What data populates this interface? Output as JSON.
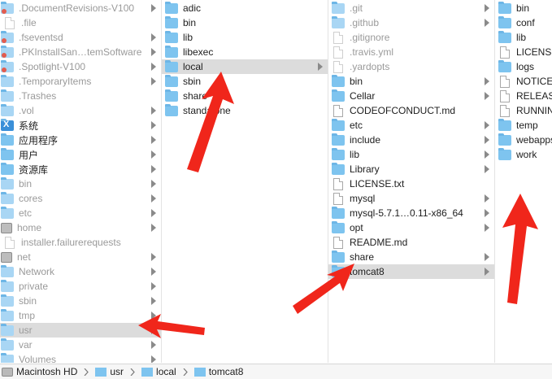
{
  "columns": [
    {
      "items": [
        {
          "label": ".DocumentRevisions-V100",
          "icon": "folder",
          "hidden": true,
          "badge": true,
          "chevron": true
        },
        {
          "label": ".file",
          "icon": "file",
          "hidden": true
        },
        {
          "label": ".fseventsd",
          "icon": "folder",
          "hidden": true,
          "badge": true,
          "chevron": true
        },
        {
          "label": ".PKInstallSan…temSoftware",
          "icon": "folder",
          "hidden": true,
          "badge": true,
          "chevron": true
        },
        {
          "label": ".Spotlight-V100",
          "icon": "folder",
          "hidden": true,
          "badge": true,
          "chevron": true
        },
        {
          "label": ".TemporaryItems",
          "icon": "folder",
          "hidden": true,
          "chevron": true
        },
        {
          "label": ".Trashes",
          "icon": "folder",
          "hidden": true
        },
        {
          "label": ".vol",
          "icon": "folder",
          "hidden": true,
          "chevron": true
        },
        {
          "label": "系统",
          "icon": "system",
          "chevron": true
        },
        {
          "label": "应用程序",
          "icon": "folder",
          "chevron": true
        },
        {
          "label": "用户",
          "icon": "folder",
          "chevron": true
        },
        {
          "label": "资源库",
          "icon": "folder",
          "chevron": true
        },
        {
          "label": "bin",
          "icon": "folder",
          "hidden": true,
          "chevron": true
        },
        {
          "label": "cores",
          "icon": "folder",
          "hidden": true,
          "chevron": true
        },
        {
          "label": "etc",
          "icon": "folder",
          "hidden": true,
          "chevron": true
        },
        {
          "label": "home",
          "icon": "disk",
          "hidden": true,
          "chevron": true
        },
        {
          "label": "installer.failurerequests",
          "icon": "file",
          "hidden": true
        },
        {
          "label": "net",
          "icon": "disk",
          "hidden": true,
          "chevron": true
        },
        {
          "label": "Network",
          "icon": "folder",
          "hidden": true,
          "chevron": true
        },
        {
          "label": "private",
          "icon": "folder",
          "hidden": true,
          "chevron": true
        },
        {
          "label": "sbin",
          "icon": "folder",
          "hidden": true,
          "chevron": true
        },
        {
          "label": "tmp",
          "icon": "folder",
          "hidden": true,
          "chevron": true
        },
        {
          "label": "usr",
          "icon": "folder",
          "hidden": true,
          "selected": true,
          "chevron": true
        },
        {
          "label": "var",
          "icon": "folder",
          "hidden": true,
          "chevron": true
        },
        {
          "label": "Volumes",
          "icon": "folder",
          "hidden": true,
          "chevron": true
        }
      ]
    },
    {
      "items": [
        {
          "label": "adic",
          "icon": "folder"
        },
        {
          "label": "bin",
          "icon": "folder"
        },
        {
          "label": "lib",
          "icon": "folder"
        },
        {
          "label": "libexec",
          "icon": "folder"
        },
        {
          "label": "local",
          "icon": "folder",
          "selected": true,
          "chevron": true
        },
        {
          "label": "sbin",
          "icon": "folder"
        },
        {
          "label": "share",
          "icon": "folder"
        },
        {
          "label": "standalone",
          "icon": "folder"
        }
      ]
    },
    {
      "items": [
        {
          "label": ".git",
          "icon": "folder",
          "hidden": true,
          "chevron": true
        },
        {
          "label": ".github",
          "icon": "folder",
          "hidden": true,
          "chevron": true
        },
        {
          "label": ".gitignore",
          "icon": "file",
          "hidden": true
        },
        {
          "label": ".travis.yml",
          "icon": "file",
          "hidden": true
        },
        {
          "label": ".yardopts",
          "icon": "file",
          "hidden": true
        },
        {
          "label": "bin",
          "icon": "folder",
          "chevron": true
        },
        {
          "label": "Cellar",
          "icon": "folder",
          "chevron": true
        },
        {
          "label": "CODEOFCONDUCT.md",
          "icon": "file"
        },
        {
          "label": "etc",
          "icon": "folder",
          "chevron": true
        },
        {
          "label": "include",
          "icon": "folder",
          "chevron": true
        },
        {
          "label": "lib",
          "icon": "folder",
          "chevron": true
        },
        {
          "label": "Library",
          "icon": "folder",
          "chevron": true
        },
        {
          "label": "LICENSE.txt",
          "icon": "file"
        },
        {
          "label": "mysql",
          "icon": "alias",
          "chevron": true
        },
        {
          "label": "mysql-5.7.1…0.11-x86_64",
          "icon": "folder",
          "chevron": true
        },
        {
          "label": "opt",
          "icon": "folder",
          "chevron": true
        },
        {
          "label": "README.md",
          "icon": "file"
        },
        {
          "label": "share",
          "icon": "folder",
          "chevron": true
        },
        {
          "label": "tomcat8",
          "icon": "folder",
          "selected": true,
          "chevron": true
        }
      ]
    },
    {
      "items": [
        {
          "label": "bin",
          "icon": "folder"
        },
        {
          "label": "conf",
          "icon": "folder"
        },
        {
          "label": "lib",
          "icon": "folder"
        },
        {
          "label": "LICENSE",
          "icon": "file"
        },
        {
          "label": "logs",
          "icon": "folder"
        },
        {
          "label": "NOTICE",
          "icon": "file"
        },
        {
          "label": "RELEASE",
          "icon": "file"
        },
        {
          "label": "RUNNING",
          "icon": "file"
        },
        {
          "label": "temp",
          "icon": "folder"
        },
        {
          "label": "webapps",
          "icon": "folder"
        },
        {
          "label": "work",
          "icon": "folder"
        }
      ]
    }
  ],
  "pathbar": {
    "crumbs": [
      {
        "label": "Macintosh HD",
        "icon": "disk"
      },
      {
        "label": "usr",
        "icon": "folder"
      },
      {
        "label": "local",
        "icon": "folder"
      },
      {
        "label": "tomcat8",
        "icon": "folder"
      }
    ]
  },
  "colors": {
    "folder": "#7ec4ef",
    "selection": "#dcdcdc",
    "annotation_arrow": "#f0261b"
  },
  "icons": {
    "chevron": "chevron-right-icon",
    "folder": "folder-icon",
    "file": "file-icon"
  }
}
